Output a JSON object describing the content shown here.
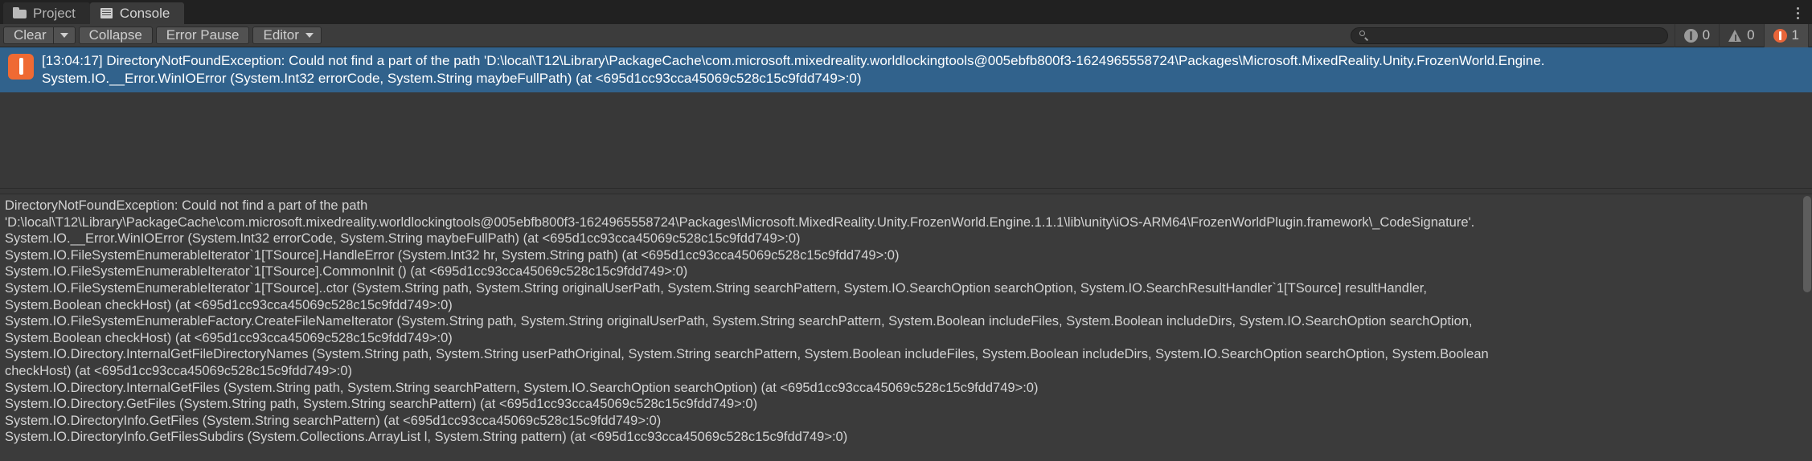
{
  "window": {
    "title": "Console",
    "menu_icon": "kebab-menu-icon"
  },
  "tabs": [
    {
      "label": "Project",
      "icon": "folder-icon",
      "active": false
    },
    {
      "label": "Console",
      "icon": "console-lines-icon",
      "active": true
    }
  ],
  "toolbar": {
    "clear_label": "Clear",
    "clear_dropdown_icon": "chevron-down-icon",
    "collapse_label": "Collapse",
    "error_pause_label": "Error Pause",
    "editor_label": "Editor",
    "editor_dropdown_icon": "chevron-down-icon",
    "search": {
      "placeholder": "",
      "value": "",
      "icon": "search-icon"
    },
    "counters": [
      {
        "name": "info",
        "icon": "info-badge-icon",
        "count": "0",
        "active": false
      },
      {
        "name": "warning",
        "icon": "warning-triangle-icon",
        "count": "0",
        "active": false
      },
      {
        "name": "error",
        "icon": "error-badge-icon",
        "count": "1",
        "active": true
      }
    ]
  },
  "log_entries": [
    {
      "severity": "error",
      "icon": "error-badge-icon",
      "selected": true,
      "line1": "[13:04:17] DirectoryNotFoundException: Could not find a part of the path 'D:\\local\\T12\\Library\\PackageCache\\com.microsoft.mixedreality.worldlockingtools@005ebfb800f3-1624965558724\\Packages\\Microsoft.MixedReality.Unity.FrozenWorld.Engine.",
      "line2": "System.IO.__Error.WinIOError (System.Int32 errorCode, System.String maybeFullPath) (at <695d1cc93cca45069c528c15c9fdd749>:0)"
    }
  ],
  "detail": {
    "lines": [
      "DirectoryNotFoundException: Could not find a part of the path",
      "'D:\\local\\T12\\Library\\PackageCache\\com.microsoft.mixedreality.worldlockingtools@005ebfb800f3-1624965558724\\Packages\\Microsoft.MixedReality.Unity.FrozenWorld.Engine.1.1.1\\lib\\unity\\iOS-ARM64\\FrozenWorldPlugin.framework\\_CodeSignature'.",
      "System.IO.__Error.WinIOError (System.Int32 errorCode, System.String maybeFullPath) (at <695d1cc93cca45069c528c15c9fdd749>:0)",
      "System.IO.FileSystemEnumerableIterator`1[TSource].HandleError (System.Int32 hr, System.String path) (at <695d1cc93cca45069c528c15c9fdd749>:0)",
      "System.IO.FileSystemEnumerableIterator`1[TSource].CommonInit () (at <695d1cc93cca45069c528c15c9fdd749>:0)",
      "System.IO.FileSystemEnumerableIterator`1[TSource]..ctor (System.String path, System.String originalUserPath, System.String searchPattern, System.IO.SearchOption searchOption, System.IO.SearchResultHandler`1[TSource] resultHandler,",
      "System.Boolean checkHost) (at <695d1cc93cca45069c528c15c9fdd749>:0)",
      "System.IO.FileSystemEnumerableFactory.CreateFileNameIterator (System.String path, System.String originalUserPath, System.String searchPattern, System.Boolean includeFiles, System.Boolean includeDirs, System.IO.SearchOption searchOption,",
      "System.Boolean checkHost) (at <695d1cc93cca45069c528c15c9fdd749>:0)",
      "System.IO.Directory.InternalGetFileDirectoryNames (System.String path, System.String userPathOriginal, System.String searchPattern, System.Boolean includeFiles, System.Boolean includeDirs, System.IO.SearchOption searchOption, System.Boolean",
      "checkHost) (at <695d1cc93cca45069c528c15c9fdd749>:0)",
      "System.IO.Directory.InternalGetFiles (System.String path, System.String searchPattern, System.IO.SearchOption searchOption) (at <695d1cc93cca45069c528c15c9fdd749>:0)",
      "System.IO.Directory.GetFiles (System.String path, System.String searchPattern) (at <695d1cc93cca45069c528c15c9fdd749>:0)",
      "System.IO.DirectoryInfo.GetFiles (System.String searchPattern) (at <695d1cc93cca45069c528c15c9fdd749>:0)",
      "System.IO.DirectoryInfo.GetFilesSubdirs (System.Collections.ArrayList l, System.String pattern) (at <695d1cc93cca45069c528c15c9fdd749>:0)"
    ]
  },
  "colors": {
    "window_bg": "#383838",
    "tabstrip_bg": "#212121",
    "toolbar_bg": "#3c3c3c",
    "selection_blue": "#31628c",
    "error_orange": "#ef6a33",
    "detail_bg": "#3b3b3b",
    "text": "#c8c8c8"
  }
}
